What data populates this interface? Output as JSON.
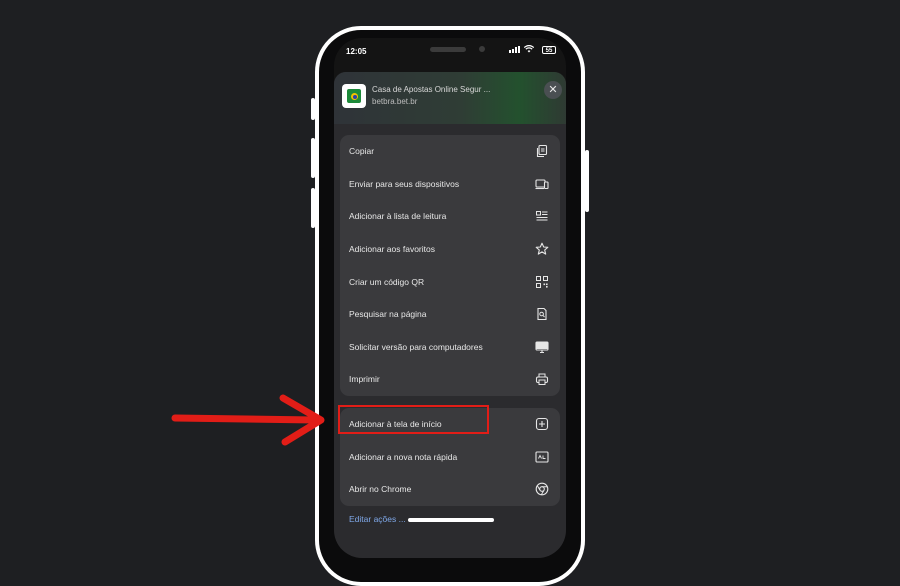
{
  "status_bar": {
    "time": "12:05",
    "battery": "55"
  },
  "site": {
    "title": "Casa de Apostas Online Segur ...",
    "url": "betbra.bet.br",
    "close_glyph": "✕"
  },
  "menu_group_1": [
    {
      "label": "Copiar",
      "icon": "copy-icon"
    },
    {
      "label": "Enviar para seus dispositivos",
      "icon": "devices-icon"
    },
    {
      "label": "Adicionar à lista de leitura",
      "icon": "reading-list-icon"
    },
    {
      "label": "Adicionar aos favoritos",
      "icon": "star-icon"
    },
    {
      "label": "Criar um código QR",
      "icon": "qr-code-icon"
    },
    {
      "label": "Pesquisar na página",
      "icon": "find-in-page-icon"
    },
    {
      "label": "Solicitar versão para computadores",
      "icon": "desktop-icon"
    },
    {
      "label": "Imprimir",
      "icon": "print-icon"
    }
  ],
  "menu_group_2": [
    {
      "label": "Adicionar à tela de início",
      "icon": "add-to-home-icon"
    },
    {
      "label": "Adicionar a nova nota rápida",
      "icon": "quick-note-icon"
    },
    {
      "label": "Abrir no Chrome",
      "icon": "chrome-icon"
    }
  ],
  "footer": {
    "edit_actions": "Editar ações ..."
  },
  "annotation": {
    "arrow_color": "#e21d17",
    "highlight_color": "#e21d17"
  }
}
